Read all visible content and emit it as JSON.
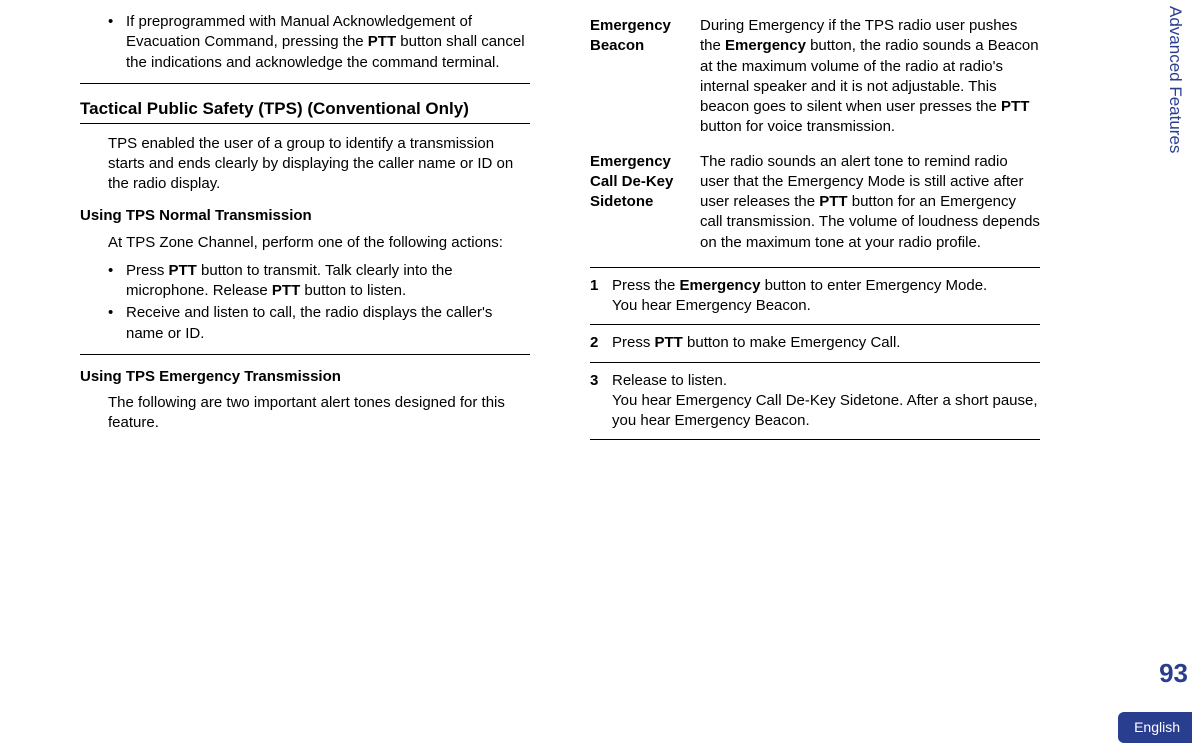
{
  "sidebar": {
    "section_title": "Advanced Features",
    "page_number": "93",
    "language": "English"
  },
  "left": {
    "top_bullet_pre": "If preprogrammed with Manual Acknowledgement of Evacuation Command, pressing the ",
    "top_bullet_bold": "PTT",
    "top_bullet_post": " button shall cancel the indications and acknowledge the command terminal.",
    "h2": "Tactical Public Safety (TPS) (Conventional Only)",
    "h2_body": "TPS enabled the user of a group to identify a transmission starts and ends clearly by displaying the caller name or ID on the radio display.",
    "h3_normal": "Using TPS Normal Transmission",
    "normal_intro": "At TPS Zone Channel, perform one of the following actions:",
    "normal_b1_pre": "Press ",
    "normal_b1_bold1": "PTT",
    "normal_b1_mid": " button to transmit. Talk clearly into the microphone. Release ",
    "normal_b1_bold2": "PTT",
    "normal_b1_post": " button to listen.",
    "normal_b2": "Receive and listen to call, the radio displays the caller's name or ID.",
    "h3_emerg": "Using TPS Emergency Transmission",
    "emerg_intro": "The following are two important alert tones designed for this feature."
  },
  "right": {
    "def1_term": "Emergency Beacon",
    "def1_pre": "During Emergency if the TPS radio user pushes the ",
    "def1_bold1": "Emergency",
    "def1_mid": " button, the radio sounds a Beacon at the maximum volume of the radio at radio's internal speaker and it is not adjustable. This beacon goes to silent when user presses the ",
    "def1_bold2": "PTT",
    "def1_post": " button for voice transmission.",
    "def2_term": "Emergency Call De-Key Sidetone",
    "def2_pre": "The radio sounds an alert tone to remind radio user that the Emergency Mode is still active after user releases the ",
    "def2_bold": "PTT",
    "def2_post": " button for an Emergency call transmission. The volume of loudness depends on the maximum tone at your radio profile.",
    "step1_num": "1",
    "step1_pre": "Press the ",
    "step1_bold": "Emergency",
    "step1_mid": " button to enter Emergency Mode.",
    "step1_after": "You hear Emergency Beacon.",
    "step2_num": "2",
    "step2_pre": "Press ",
    "step2_bold": "PTT",
    "step2_post": " button to make Emergency Call.",
    "step3_num": "3",
    "step3_line1": "Release to listen.",
    "step3_line2": "You hear Emergency Call De-Key Sidetone. After a short pause, you hear Emergency Beacon."
  }
}
